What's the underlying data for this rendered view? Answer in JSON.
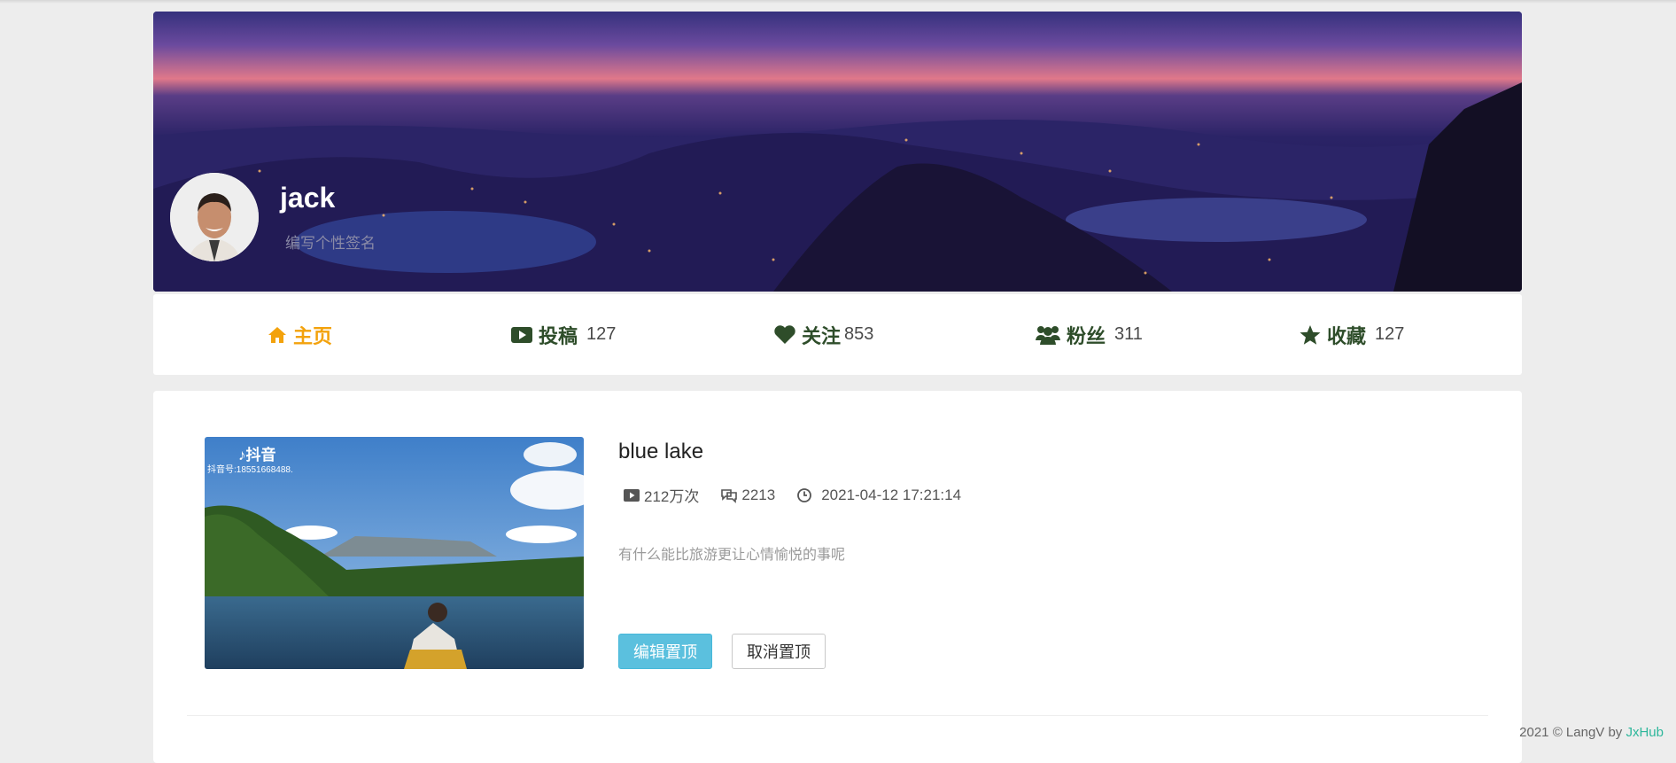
{
  "profile": {
    "username": "jack",
    "signature": "编写个性签名"
  },
  "nav": {
    "home_label": "主页",
    "posts_label": "投稿",
    "posts_count": "127",
    "following_label": "关注",
    "following_count": "853",
    "fans_label": "粉丝",
    "fans_count": "311",
    "favorites_label": "收藏",
    "favorites_count": "127",
    "active_color": "#f3a20c",
    "text_color": "#2e4d2a"
  },
  "video": {
    "title": "blue lake",
    "views": "212万次",
    "comments": "2213",
    "date": "2021-04-12 17:21:14",
    "description": "有什么能比旅游更让心情愉悦的事呢",
    "thumb_logo": "♪抖音",
    "thumb_id": "抖音号:18551668488."
  },
  "buttons": {
    "edit_pin": "编辑置顶",
    "cancel_pin": "取消置顶"
  },
  "footer": {
    "copyright": "2021 © LangV by ",
    "link": "JxHub"
  }
}
